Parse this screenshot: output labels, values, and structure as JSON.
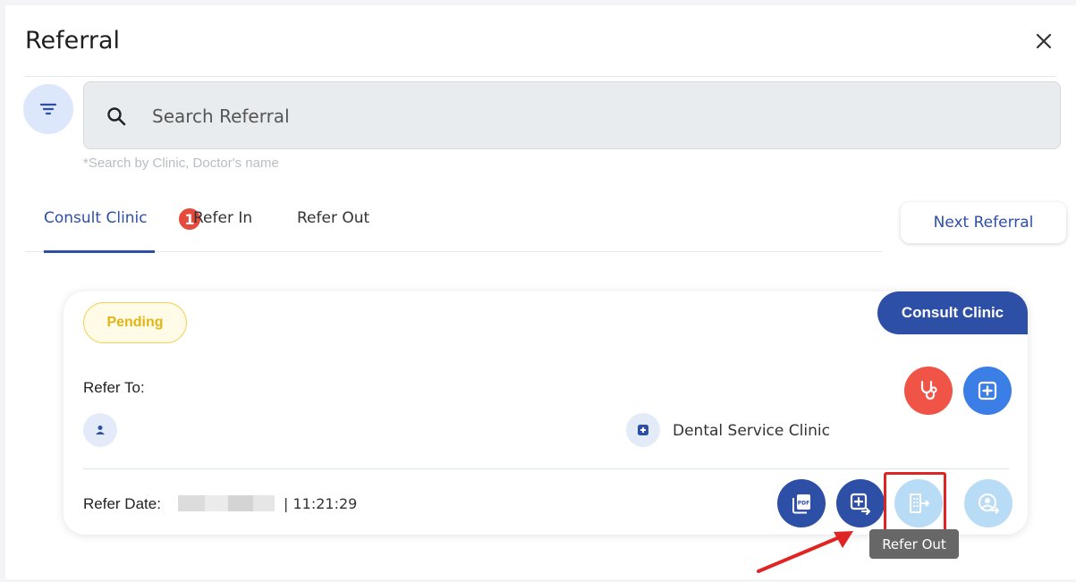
{
  "dialog": {
    "title": "Referral"
  },
  "search": {
    "placeholder": "Search Referral",
    "value": "",
    "hint": "*Search by Clinic, Doctor's name"
  },
  "tabs": [
    {
      "label": "Consult Clinic",
      "active": true,
      "badge": "1"
    },
    {
      "label": "Refer In",
      "active": false
    },
    {
      "label": "Refer Out",
      "active": false
    }
  ],
  "next_button": {
    "label": "Next Referral"
  },
  "card": {
    "status": "Pending",
    "type": "Consult Clinic",
    "refer_to_label": "Refer To:",
    "clinic_name": "Dental Service Clinic",
    "refer_date_label": "Refer Date:",
    "refer_time": "| 11:21:29"
  },
  "tooltip": {
    "label": "Refer Out"
  },
  "colors": {
    "primary": "#2e4fa6",
    "accent_blue": "#3b7ee6",
    "danger": "#f05446",
    "pending": "#f2d15a",
    "disabled": "#b9dcf6"
  }
}
